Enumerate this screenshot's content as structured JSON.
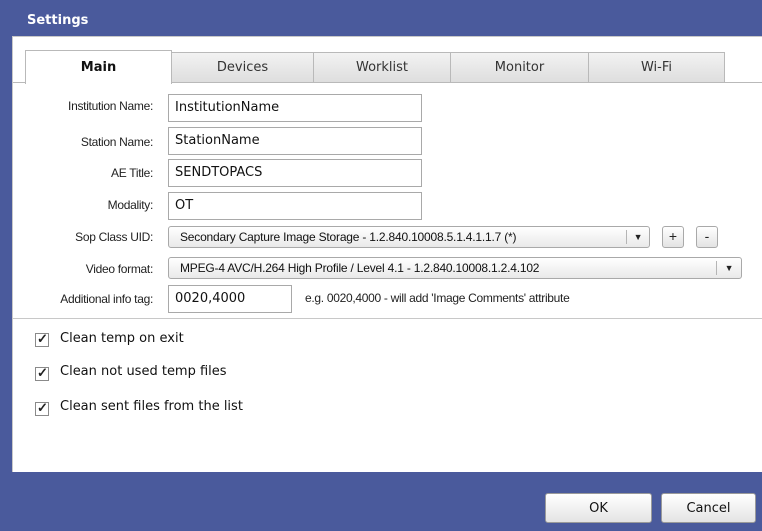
{
  "window": {
    "title": "Settings"
  },
  "tabs": [
    {
      "label": "Main"
    },
    {
      "label": "Devices"
    },
    {
      "label": "Worklist"
    },
    {
      "label": "Monitor"
    },
    {
      "label": "Wi-Fi"
    }
  ],
  "form": {
    "institution_name": {
      "label": "Institution Name:",
      "value": "InstitutionName"
    },
    "station_name": {
      "label": "Station Name:",
      "value": "StationName"
    },
    "ae_title": {
      "label": "AE Title:",
      "value": "SENDTOPACS"
    },
    "modality": {
      "label": "Modality:",
      "value": "OT"
    },
    "sop_class_uid": {
      "label": "Sop Class UID:",
      "value": "Secondary Capture Image Storage - 1.2.840.10008.5.1.4.1.1.7 (*)",
      "add_label": "+",
      "remove_label": "-"
    },
    "video_format": {
      "label": "Video format:",
      "value": "MPEG-4 AVC/H.264 High Profile / Level 4.1 - 1.2.840.10008.1.2.4.102"
    },
    "additional_info_tag": {
      "label": "Additional info tag:",
      "value": "0020,4000",
      "hint": "e.g. 0020,4000 - will add 'Image Comments' attribute"
    }
  },
  "options": [
    {
      "label": "Clean temp on exit",
      "checked": true
    },
    {
      "label": "Clean not used temp files",
      "checked": true
    },
    {
      "label": "Clean sent files from the list",
      "checked": true
    }
  ],
  "buttons": {
    "ok": "OK",
    "cancel": "Cancel"
  },
  "icons": {
    "dropdown": "chevron-down-icon",
    "check": "check-icon"
  },
  "colors": {
    "titlebar": "#4a5a9c",
    "panel": "#ffffff"
  }
}
